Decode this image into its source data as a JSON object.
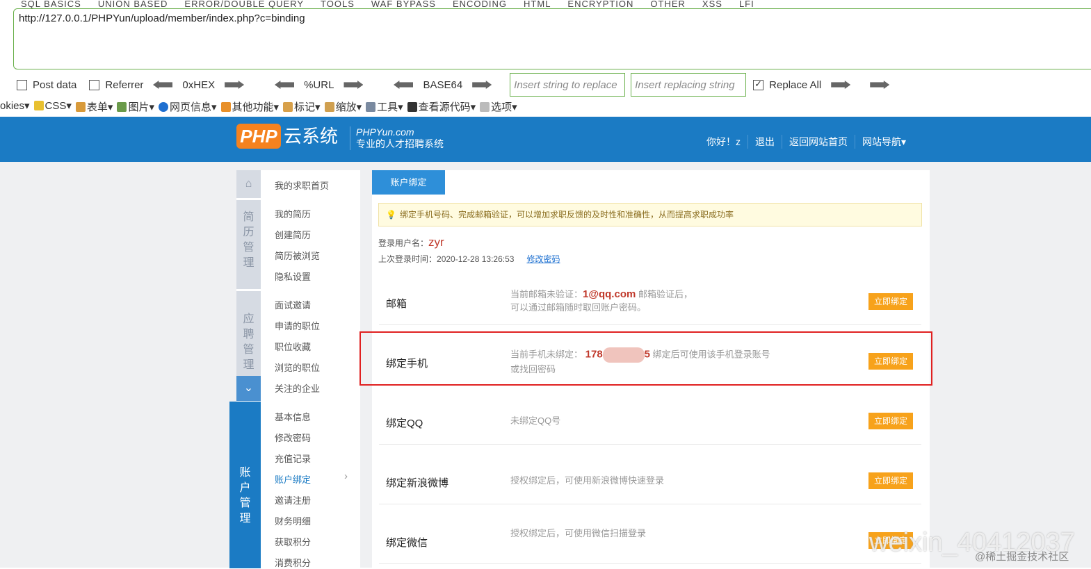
{
  "hackbar": {
    "menu": [
      "SQL BASICS",
      "UNION BASED",
      "ERROR/DOUBLE QUERY",
      "TOOLS",
      "WAF BYPASS",
      "ENCODING",
      "HTML",
      "ENCRYPTION",
      "OTHER",
      "XSS",
      "LFI"
    ],
    "url": "http://127.0.0.1/PHPYun/upload/member/index.php?c=binding",
    "post_data": "Post data",
    "referrer": "Referrer",
    "hex": "0xHEX",
    "url_enc": "%URL",
    "base64": "BASE64",
    "insert_replace": "Insert string to replace",
    "insert_replacing": "Insert replacing string",
    "replace_all": "Replace All"
  },
  "webdev": [
    "okies▾",
    "CSS▾",
    "表单▾",
    "图片▾",
    "网页信息▾",
    "其他功能▾",
    "标记▾",
    "缩放▾",
    "工具▾",
    "查看源代码▾",
    "选项▾"
  ],
  "header": {
    "logo": "PHP",
    "logo2": "云系统",
    "site": "PHPYun.com",
    "slogan": "专业的人才招聘系统",
    "greet": "你好！z",
    "logout": "退出",
    "home": "返回网站首页",
    "nav": "网站导航▾"
  },
  "sidebar": {
    "home": "我的求职首页",
    "g1": [
      "简",
      "历",
      "管",
      "理"
    ],
    "g1items": [
      "我的简历",
      "创建简历",
      "简历被浏览",
      "隐私设置"
    ],
    "g2": [
      "应",
      "聘",
      "管",
      "理"
    ],
    "g2items": [
      "面试邀请",
      "申请的职位",
      "职位收藏",
      "浏览的职位",
      "关注的企业"
    ],
    "g3": [
      "账",
      "户",
      "管",
      "理"
    ],
    "g3items": [
      "基本信息",
      "修改密码",
      "充值记录",
      "账户绑定",
      "邀请注册",
      "财务明细",
      "获取积分",
      "消费积分"
    ]
  },
  "main": {
    "tab": "账户绑定",
    "tip": "绑定手机号码、完成邮箱验证，可以增加求职反馈的及时性和准确性，从而提高求职成功率",
    "user_label": "登录用户名：",
    "user": "zyr",
    "last_label": "上次登录时间：",
    "last": "2020-12-28 13:26:53",
    "change_pwd": "修改密码",
    "btn": "立即绑定",
    "email": {
      "name": "邮箱",
      "pre": "当前邮箱未验证：",
      "val": "1@qq.com",
      "post": " 邮箱验证后，",
      "line2": "可以通过邮箱随时取回账户密码。"
    },
    "phone": {
      "name": "绑定手机",
      "pre": "当前手机未绑定：",
      "val": "178",
      "tail": "5",
      "post": " 绑定后可使用该手机登录账号",
      "line2": "或找回密码"
    },
    "qq": {
      "name": "绑定QQ",
      "desc": "未绑定QQ号"
    },
    "weibo": {
      "name": "绑定新浪微博",
      "desc": "授权绑定后，可使用新浪微博快速登录"
    },
    "wechat": {
      "name": "绑定微信",
      "desc": "授权绑定后，可使用微信扫描登录"
    }
  },
  "watermark": {
    "a": "weixin_40412037",
    "b": "@稀土掘金技术社区"
  }
}
